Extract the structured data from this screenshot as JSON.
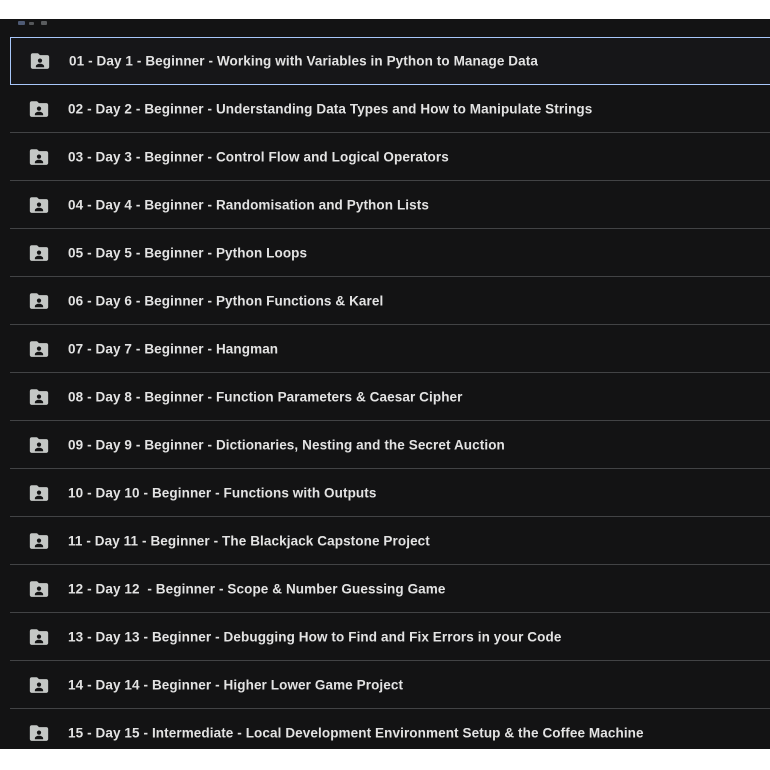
{
  "colors": {
    "background": "#131314",
    "selected_background": "#161618",
    "divider": "#424345",
    "text": "#e3e3e3",
    "icon": "#c4c7c5",
    "selection_border": "#a8c7fa",
    "page_gap": "#ffffff"
  },
  "file_list": {
    "selected_index": 0,
    "row_icon": "shared-folder-icon",
    "items": [
      {
        "label": "01 - Day 1 - Beginner - Working with Variables in Python to Manage Data"
      },
      {
        "label": "02 - Day 2 - Beginner - Understanding Data Types and How to Manipulate Strings"
      },
      {
        "label": "03 - Day 3 - Beginner - Control Flow and Logical Operators"
      },
      {
        "label": "04 - Day 4 - Beginner - Randomisation and Python Lists"
      },
      {
        "label": "05 - Day 5 - Beginner - Python Loops"
      },
      {
        "label": "06 - Day 6 - Beginner - Python Functions & Karel"
      },
      {
        "label": "07 - Day 7 - Beginner - Hangman"
      },
      {
        "label": "08 - Day 8 - Beginner - Function Parameters & Caesar Cipher"
      },
      {
        "label": "09 - Day 9 - Beginner - Dictionaries, Nesting and the Secret Auction"
      },
      {
        "label": "10 - Day 10 - Beginner - Functions with Outputs"
      },
      {
        "label": "11 - Day 11 - Beginner - The Blackjack Capstone Project"
      },
      {
        "label": "12 - Day 12  - Beginner - Scope & Number Guessing Game"
      },
      {
        "label": "13 - Day 13 - Beginner - Debugging How to Find and Fix Errors in your Code"
      },
      {
        "label": "14 - Day 14 - Beginner - Higher Lower Game Project"
      },
      {
        "label": "15 - Day 15 - Intermediate - Local Development Environment Setup & the Coffee Machine"
      }
    ]
  }
}
